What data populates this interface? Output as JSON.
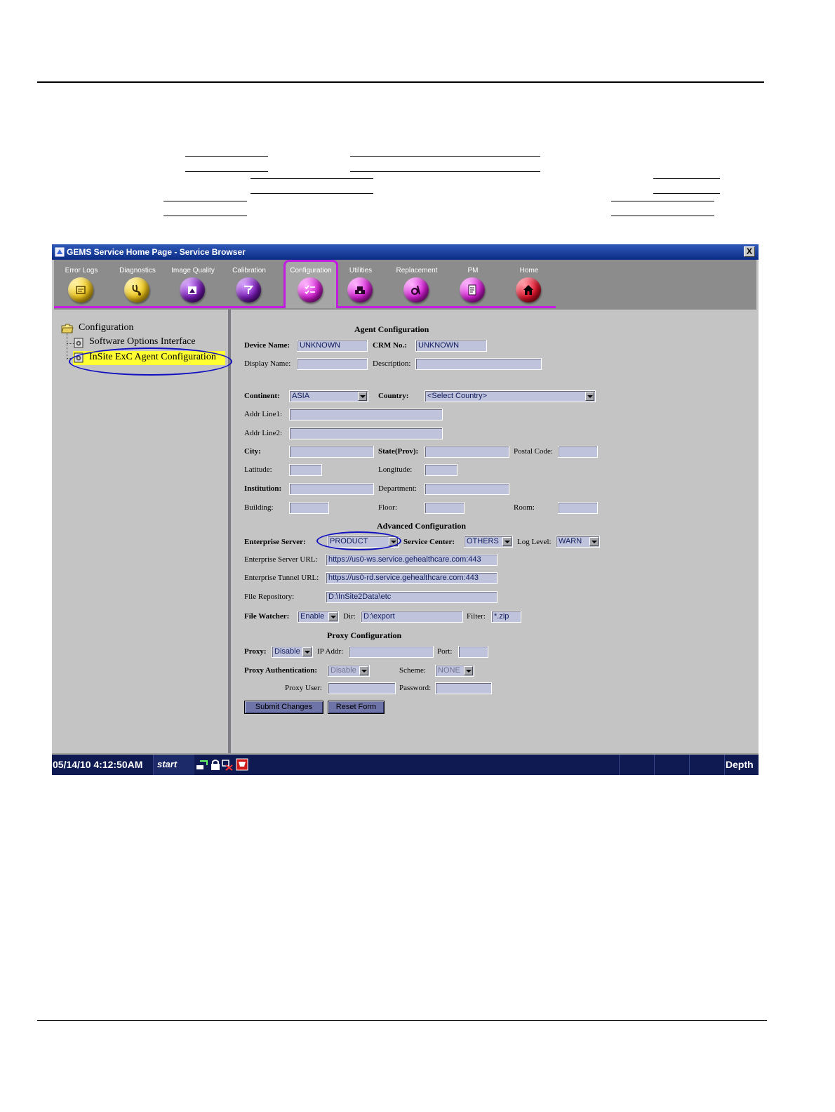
{
  "window": {
    "title": "GEMS Service Home Page - Service Browser",
    "close_label": "X"
  },
  "toolbar": {
    "items": [
      {
        "label": "Error Logs",
        "icon": "error-logs-icon",
        "color": "#f2c81a"
      },
      {
        "label": "Diagnostics",
        "icon": "stethoscope-icon",
        "color": "#f2c81a"
      },
      {
        "label": "Image Quality",
        "icon": "image-quality-icon",
        "color": "#7a1bb8"
      },
      {
        "label": "Calibration",
        "icon": "calibration-icon",
        "color": "#7a1bb8"
      },
      {
        "label": "Configuration",
        "icon": "configuration-icon",
        "color": "#d81fd8",
        "active": true
      },
      {
        "label": "Utilities",
        "icon": "utilities-icon",
        "color": "#d81fd8"
      },
      {
        "label": "Replacement",
        "icon": "replacement-icon",
        "color": "#d81fd8"
      },
      {
        "label": "PM",
        "icon": "pm-icon",
        "color": "#d81fd8"
      },
      {
        "label": "Home",
        "icon": "home-icon",
        "color": "#e0122a"
      }
    ]
  },
  "tree": {
    "root": "Configuration",
    "items": [
      "Software Options Interface",
      "InSite ExC Agent Configuration"
    ],
    "selected_index": 1
  },
  "form": {
    "agent_title": "Agent Configuration",
    "device_name_label": "Device Name:",
    "device_name_value": "UNKNOWN",
    "crm_label": "CRM No.:",
    "crm_value": "UNKNOWN",
    "display_name_label": "Display Name:",
    "display_name_value": "",
    "description_label": "Description:",
    "description_value": "",
    "continent_label": "Continent:",
    "continent_value": "ASIA",
    "country_label": "Country:",
    "country_value": "<Select Country>",
    "addr1_label": "Addr Line1:",
    "addr1_value": "",
    "addr2_label": "Addr Line2:",
    "addr2_value": "",
    "city_label": "City:",
    "city_value": "",
    "state_label": "State(Prov):",
    "state_value": "",
    "postal_label": "Postal Code:",
    "postal_value": "",
    "latitude_label": "Latitude:",
    "latitude_value": "",
    "longitude_label": "Longitude:",
    "longitude_value": "",
    "institution_label": "Institution:",
    "institution_value": "",
    "department_label": "Department:",
    "department_value": "",
    "building_label": "Building:",
    "building_value": "",
    "floor_label": "Floor:",
    "floor_value": "",
    "room_label": "Room:",
    "room_value": "",
    "advanced_title": "Advanced Configuration",
    "enterprise_server_label": "Enterprise Server:",
    "enterprise_server_value": "PRODUCT",
    "service_center_label": "Service Center:",
    "service_center_value": "OTHERS",
    "log_level_label": "Log Level:",
    "log_level_value": "WARN",
    "es_url_label": "Enterprise Server URL:",
    "es_url_value": "https://us0-ws.service.gehealthcare.com:443",
    "et_url_label": "Enterprise Tunnel URL:",
    "et_url_value": "https://us0-rd.service.gehealthcare.com:443",
    "file_repo_label": "File Repository:",
    "file_repo_value": "D:\\InSite2Data\\etc",
    "file_watcher_label": "File Watcher:",
    "file_watcher_value": "Enable",
    "dir_label": "Dir:",
    "dir_value": "D:\\export",
    "filter_label": "Filter:",
    "filter_value": "*.zip",
    "proxy_title": "Proxy Configuration",
    "proxy_label": "Proxy:",
    "proxy_value": "Disable",
    "ip_label": "IP Addr:",
    "ip_value": "",
    "port_label": "Port:",
    "port_value": "",
    "proxy_auth_label": "Proxy Authentication:",
    "proxy_auth_value": "Disable",
    "scheme_label": "Scheme:",
    "scheme_value": "NONE",
    "proxy_user_label": "Proxy User:",
    "proxy_user_value": "",
    "password_label": "Password:",
    "password_value": "",
    "submit_label": "Submit Changes",
    "reset_label": "Reset Form"
  },
  "taskbar": {
    "datetime": "05/14/10 4:12:50AM",
    "start_label": "start",
    "right_label": "Depth"
  },
  "colors": {
    "accent": "#c21ce0",
    "highlight": "#ffff33",
    "annotation": "#1010c0"
  }
}
